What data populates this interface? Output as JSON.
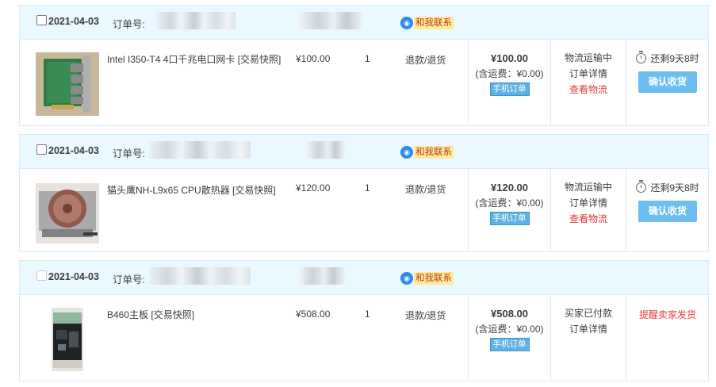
{
  "orders": [
    {
      "date": "2021-04-03",
      "order_no_label": "订单号:",
      "contact_label": "和我联系",
      "item_title": "Intel I350-T4 4口千兆电口网卡 [交易快照]",
      "unit_price": "¥100.00",
      "quantity": "1",
      "refund_label": "退款/退货",
      "total": "¥100.00",
      "shipping": "(含运费：¥0.00)",
      "mobile_tag": "手机订单",
      "status_lines": [
        "物流运输中",
        "订单详情"
      ],
      "status_link": "查看物流",
      "remaining": "还剩9天8时",
      "action_button": "确认收货"
    },
    {
      "date": "2021-04-03",
      "order_no_label": "订单号:",
      "contact_label": "和我联系",
      "item_title": "猫头鹰NH-L9x65 CPU散热器 [交易快照]",
      "unit_price": "¥120.00",
      "quantity": "1",
      "refund_label": "退款/退货",
      "total": "¥120.00",
      "shipping": "(含运费：¥0.00)",
      "mobile_tag": "手机订单",
      "status_lines": [
        "物流运输中",
        "订单详情"
      ],
      "status_link": "查看物流",
      "remaining": "还剩9天8时",
      "action_button": "确认收货"
    },
    {
      "date": "2021-04-03",
      "order_no_label": "订单号:",
      "contact_label": "和我联系",
      "item_title": "B460主板 [交易快照]",
      "unit_price": "¥508.00",
      "quantity": "1",
      "refund_label": "退款/退货",
      "total": "¥508.00",
      "shipping": "(含运费：¥0.00)",
      "mobile_tag": "手机订单",
      "status_lines": [
        "买家已付款",
        "订单详情"
      ],
      "action_link": "提醒卖家发货"
    }
  ],
  "icons": {
    "contact": "chat-bubble-icon",
    "timer": "stopwatch-icon"
  },
  "colors": {
    "header_bg": "#eaf8ff",
    "border": "#d6ecf8",
    "link_red": "#e4393c",
    "button_blue": "#6cbef0",
    "mobile_tag": "#5fb1e3"
  }
}
